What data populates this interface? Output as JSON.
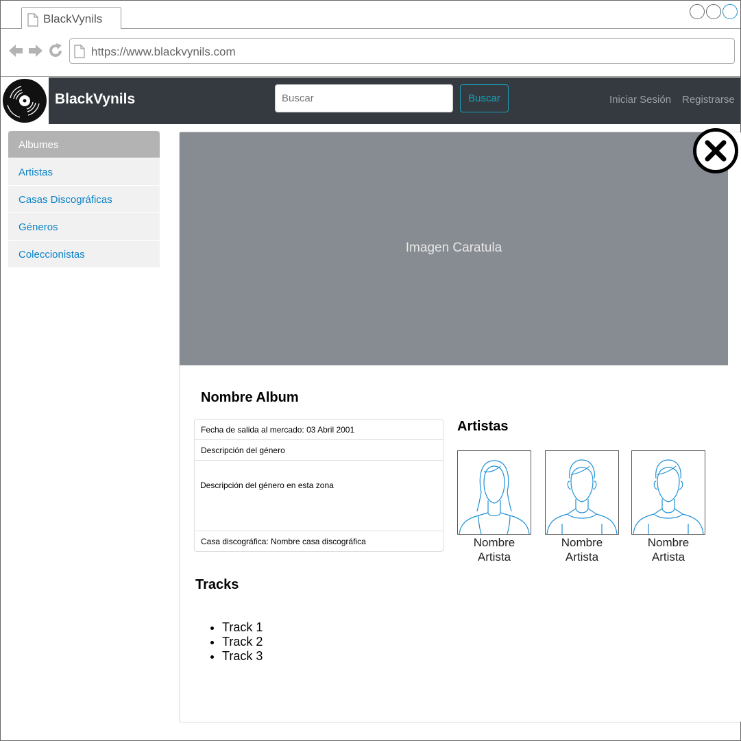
{
  "browser": {
    "tab_title": "BlackVynils",
    "url": "https://www.blackvynils.com"
  },
  "header": {
    "brand": "BlackVynils",
    "search_placeholder": "Buscar",
    "search_button": "Buscar",
    "login": "Iniciar Sesión",
    "register": "Registrarse"
  },
  "sidebar": {
    "items": [
      {
        "label": "Albumes"
      },
      {
        "label": "Artistas"
      },
      {
        "label": "Casas Discográficas"
      },
      {
        "label": "Géneros"
      },
      {
        "label": "Coleccionistas"
      }
    ]
  },
  "album": {
    "cover_label": "Imagen Caratula",
    "title": "Nombre Album",
    "release": "Fecha de salida al mercado: 03 Abril 2001",
    "genre": "Descripción del género",
    "description": "Descripción del género en esta zona",
    "label": "Casa discográfica: Nombre casa discográfica"
  },
  "artists": {
    "title": "Artistas",
    "items": [
      {
        "name_line1": "Nombre",
        "name_line2": "Artista",
        "icon": "female-avatar-icon"
      },
      {
        "name_line1": "Nombre",
        "name_line2": "Artista",
        "icon": "male-avatar-icon"
      },
      {
        "name_line1": "Nombre",
        "name_line2": "Artista",
        "icon": "male-avatar-icon"
      }
    ]
  },
  "tracks": {
    "title": "Tracks",
    "items": [
      "Track 1",
      "Track 2",
      "Track 3"
    ]
  },
  "colors": {
    "header_bg": "#343a40",
    "accent": "#17a2b8",
    "link": "#0a82c8",
    "cover_bg": "#878c92"
  }
}
